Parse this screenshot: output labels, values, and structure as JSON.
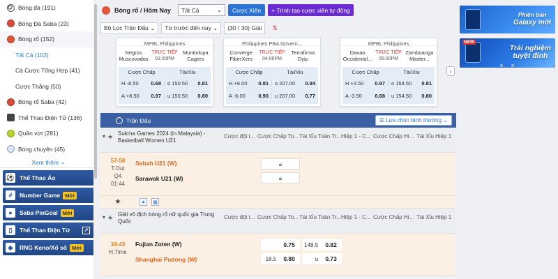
{
  "sidebar": {
    "items": [
      {
        "label": "Bóng đá",
        "count": "(191)",
        "icon": "soccer-icon"
      },
      {
        "label": "Bóng Đá Saba",
        "count": "(23)",
        "icon": "soccer-saba-icon"
      },
      {
        "label": "Bóng rổ",
        "count": "(152)",
        "icon": "basketball-icon"
      }
    ],
    "sub_items": [
      {
        "label": "Tất Cả (102)",
        "active": true
      },
      {
        "label": "Cá Cược Tổng Hợp (41)",
        "active": false
      },
      {
        "label": "Cược Thắng (50)",
        "active": false
      }
    ],
    "items2": [
      {
        "label": "Bóng rổ Saba",
        "count": "(42)",
        "icon": "basketball-saba-icon"
      },
      {
        "label": "Thể Thao Điện Tử",
        "count": "(136)",
        "icon": "esports-icon"
      },
      {
        "label": "Quần vợt",
        "count": "(281)",
        "icon": "tennis-icon"
      },
      {
        "label": "Bóng chuyền",
        "count": "(45)",
        "icon": "volleyball-icon"
      }
    ],
    "more_label": "Xem thêm",
    "blocks": [
      {
        "label": "Thể Thao Ảo",
        "badge": "",
        "external": false
      },
      {
        "label": "Number Game",
        "badge": "Mới",
        "external": false
      },
      {
        "label": "Saba PinGoal",
        "badge": "Mới",
        "external": false
      },
      {
        "label": "Thể Thao Điện Tử",
        "badge": "",
        "external": true
      },
      {
        "label": "RNG Keno/Xổ số",
        "badge": "Mới",
        "external": false
      }
    ]
  },
  "topbar": {
    "title": "Bóng rổ / Hôm Nay",
    "market_select": "Tất Cả",
    "parlay_label": "Cược Xiên",
    "auto_parlay_label": "Trình tạo cược xiên tự động"
  },
  "filters": {
    "league_filter": "Bộ Lọc Trận Đấu",
    "sort_time": "Từ trước đến nay",
    "count": "(30 / 30) Giải"
  },
  "cards": [
    {
      "league": "MPBL Philippines",
      "home": "Negros Muscovados",
      "away": "Muntinlupa Cagers",
      "status": "TRỰC TIẾP",
      "time": "03:00PM",
      "hdp_label": "Cược Chấp",
      "ou_label": "Tài/Xỉu",
      "rows": [
        {
          "side": "H",
          "line": "-8.50",
          "price": "0.68",
          "ou_side": "o",
          "ou_line": "150.50",
          "ou_price": "0.81"
        },
        {
          "side": "A",
          "line": "+8.50",
          "price": "0.97",
          "ou_side": "u",
          "ou_line": "150.50",
          "ou_price": "0.80"
        }
      ]
    },
    {
      "league": "Philippines PBA Govern...",
      "home": "Converge FiberXers",
      "away": "Terrafirma Dyip",
      "status": "TRỰC TIẾP",
      "time": "04:00PM",
      "hdp_label": "Cược Chấp",
      "ou_label": "Tài/Xỉu",
      "rows": [
        {
          "side": "H",
          "line": "+6.00",
          "price": "0.81",
          "ou_side": "o",
          "ou_line": "207.00",
          "ou_price": "0.94"
        },
        {
          "side": "A",
          "line": "-6.00",
          "price": "0.90",
          "ou_side": "u",
          "ou_line": "207.00",
          "ou_price": "0.77"
        }
      ]
    },
    {
      "league": "MPBL Philippines",
      "home": "Davao Occidental...",
      "away": "Zamboanga Master...",
      "status": "TRỰC TIẾP",
      "time": "05:00PM",
      "hdp_label": "Cược Chấp",
      "ou_label": "Tài/Xỉu",
      "rows": [
        {
          "side": "H",
          "line": "+3.50",
          "price": "0.97",
          "ou_side": "o",
          "ou_line": "154.50",
          "ou_price": "0.81"
        },
        {
          "side": "A",
          "line": "-3.50",
          "price": "0.68",
          "ou_side": "u",
          "ou_line": "154.50",
          "ou_price": "0.80"
        }
      ]
    }
  ],
  "table": {
    "header": "Trận Đấu",
    "sort_label": "Lựa chọn bình thường",
    "columns": [
      "Cược đội t...",
      "Cược Chấp To...",
      "Tài Xỉu Toàn Tr...",
      "Hiệp 1 - C...",
      "Cược Chấp Hiệ...",
      "Tài Xỉu Hiệp 1"
    ],
    "leagues": [
      {
        "name": "Sukma Games 2024 (in Malaysia) - Basketball Women U21",
        "match": {
          "score": "57-58",
          "status1": "T.Out",
          "status2": "Q4",
          "status3": "01:44",
          "home": "Sabah U21 (W)",
          "away": "Sarawak U21 (W)"
        }
      },
      {
        "name": "Giải vô địch bóng rổ nữ quốc gia Trung Quốc",
        "match": {
          "score": "34-43",
          "status1": "H.Time",
          "home": "Fujian Zoten (W)",
          "away": "Shanghai Pudong (W)",
          "hdp_home_price": "0.75",
          "hdp_away_line": "18.5",
          "hdp_away_price": "0.80",
          "ou_over_line": "148.5",
          "ou_over_price": "0.82",
          "ou_under_side": "u",
          "ou_under_price": "0.73"
        }
      }
    ]
  },
  "banners": [
    {
      "line1": "Phiên bản",
      "line2": "Galaxy mới"
    },
    {
      "tag": "NEW",
      "line1": "Trải nghiệm",
      "line2": "tuyệt đỉnh"
    }
  ],
  "colors": {
    "accent": "#2b73d4",
    "header_blue": "#3a5fa2",
    "live_red": "#e03a3a",
    "match_bg": "#fcefe4",
    "score_orange": "#e07b10",
    "purple": "#6b2bd3"
  }
}
